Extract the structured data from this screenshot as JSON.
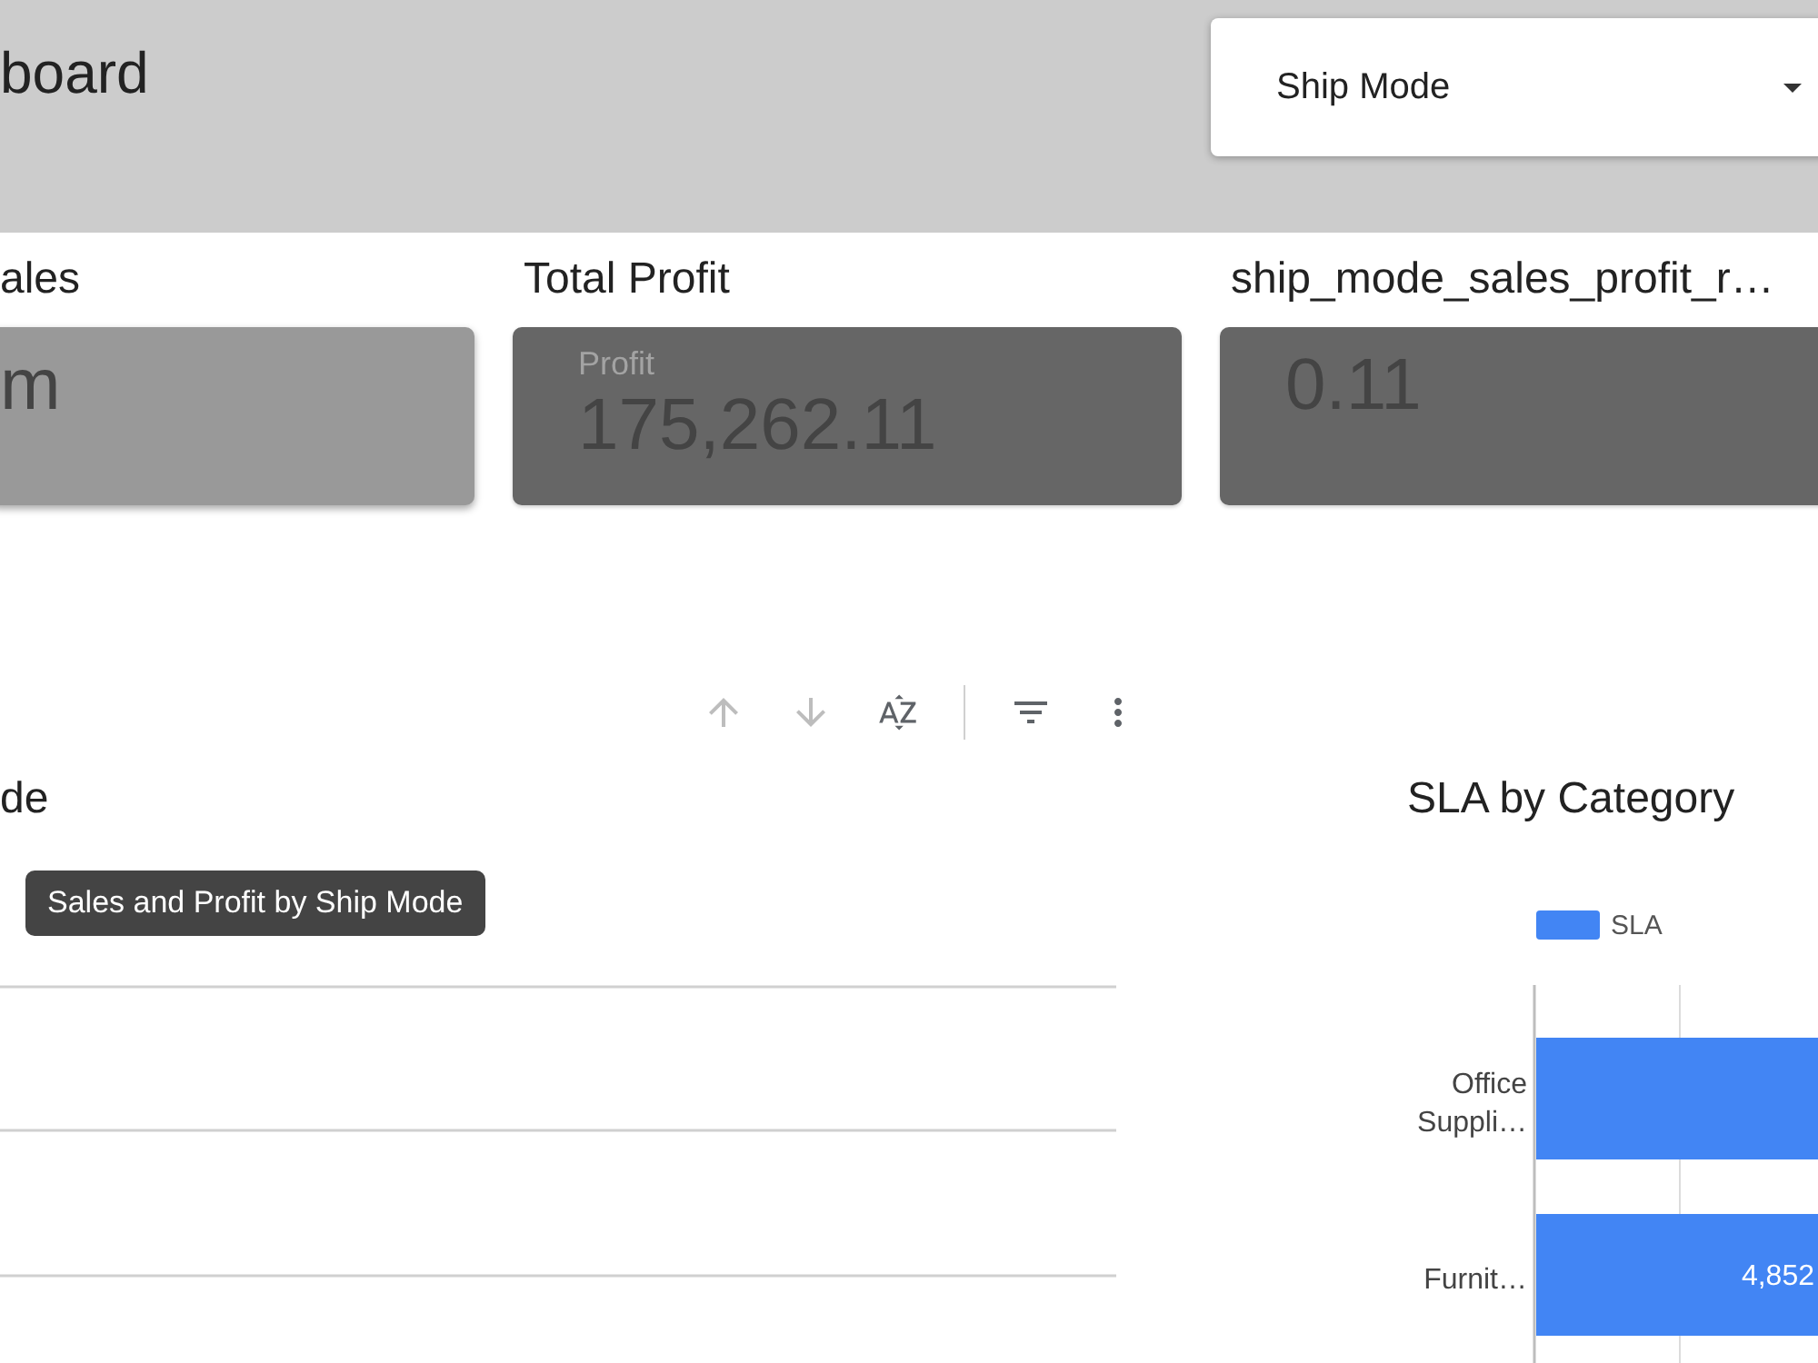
{
  "header": {
    "title": "board",
    "filter": {
      "label": "Ship Mode"
    }
  },
  "kpis": [
    {
      "title": "ales",
      "color": "#999999",
      "value": "m"
    },
    {
      "title": "Total Profit",
      "color": "#666666",
      "label": "Profit",
      "value": "175,262.11"
    },
    {
      "title": "ship_mode_sales_profit_r…",
      "color": "#666666",
      "value": "0.11"
    }
  ],
  "chart_toolbar": [
    {
      "kind": "sort-ascending",
      "disabled": true
    },
    {
      "kind": "sort-descending",
      "disabled": true
    },
    {
      "kind": "sort-alpha",
      "disabled": false
    },
    {
      "kind": "divider"
    },
    {
      "kind": "filter",
      "disabled": false
    },
    {
      "kind": "more",
      "disabled": false
    }
  ],
  "ship_mode_chart": {
    "title": "de",
    "tooltip": "Sales and Profit by Ship Mode"
  },
  "sla_chart": {
    "title": "SLA by Category",
    "legend": [
      {
        "label": "SLA",
        "color": "#4285f4"
      }
    ],
    "bars": [
      {
        "category": "Office Suppli…"
      },
      {
        "category": "Furnit…",
        "value_label": "4,852"
      }
    ]
  }
}
